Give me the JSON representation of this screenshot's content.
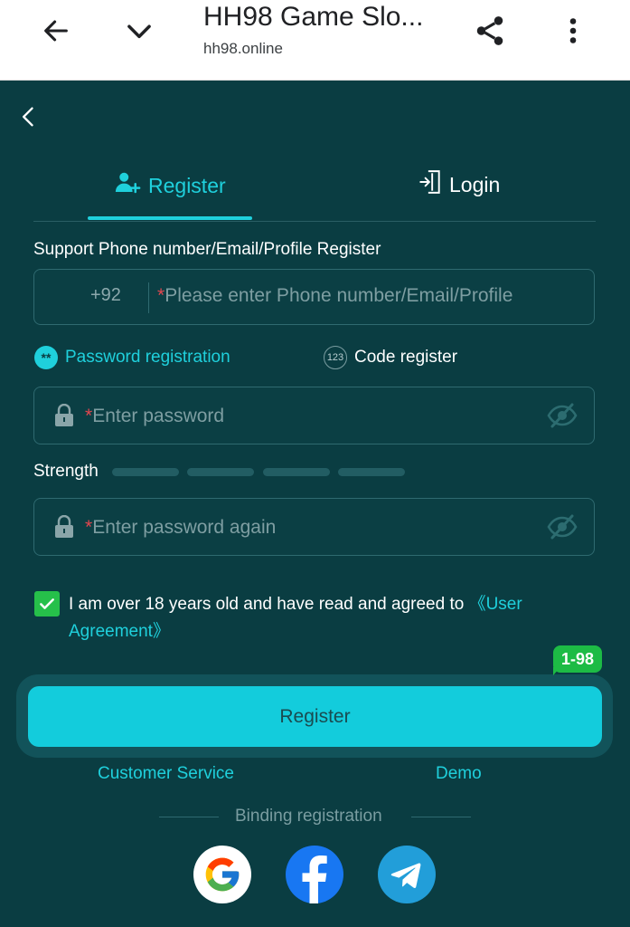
{
  "browser": {
    "title": "HH98 Game Slo...",
    "url": "hh98.online"
  },
  "tabs": [
    {
      "label": "Register"
    },
    {
      "label": "Login"
    }
  ],
  "form": {
    "account_label": "Support Phone number/Email/Profile Register",
    "country_code": "+92",
    "account_placeholder": "Please enter Phone number/Email/Profile",
    "options": [
      {
        "label": "Password registration",
        "icon": "**"
      },
      {
        "label": "Code register",
        "icon": "123"
      }
    ],
    "password_placeholder": "Enter password",
    "strength_label": "Strength",
    "password_again_placeholder": "Enter password again",
    "required_mark": "*",
    "agree_text": "I am over 18 years old and have read and agreed to ",
    "agree_link": "《User Agreement》",
    "agree_checked": true,
    "badge": "1-98",
    "register_button": "Register",
    "customer_service": "Customer Service",
    "demo": "Demo",
    "binding_label": "Binding registration"
  },
  "social": [
    "google-icon",
    "facebook-icon",
    "telegram-icon"
  ],
  "colors": {
    "background": "#0a3d42",
    "accent": "#1fd0dc",
    "button": "#13ccdc",
    "check": "#26c04a",
    "required": "#e2464f"
  }
}
